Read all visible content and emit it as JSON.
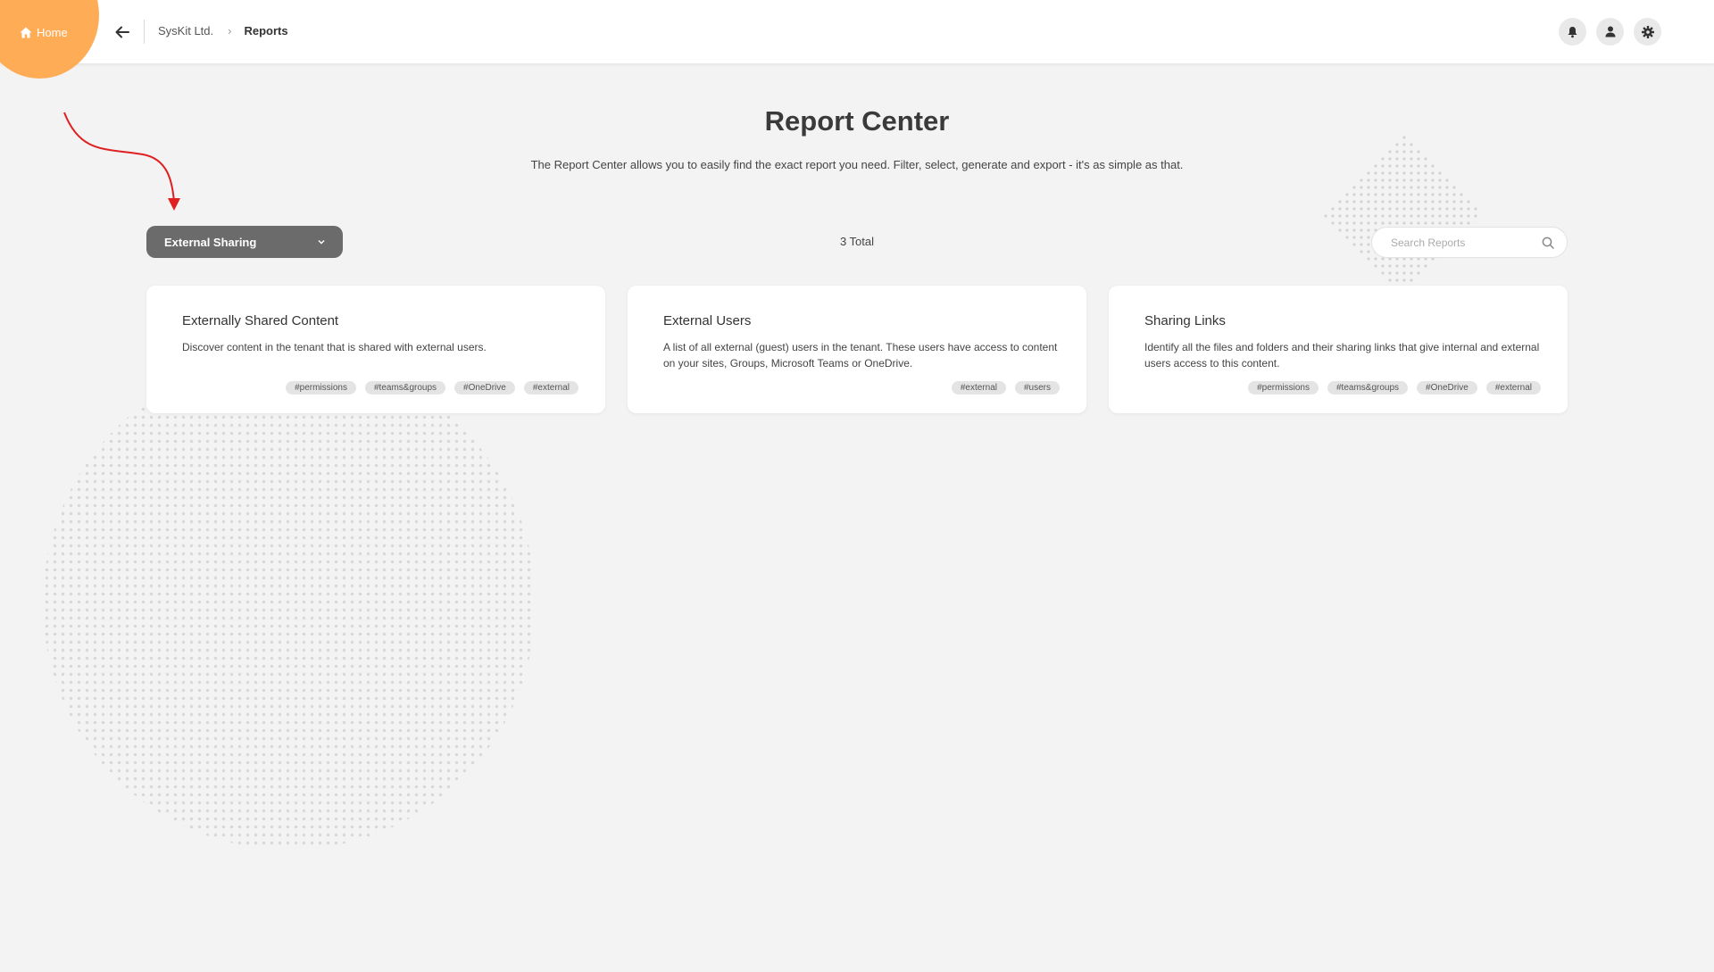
{
  "nav": {
    "home_label": "Home",
    "breadcrumb": {
      "root": "SysKit Ltd.",
      "current": "Reports"
    }
  },
  "header": {
    "title": "Report Center",
    "subtitle": "The Report Center allows you to easily find the exact report you need. Filter, select, generate and export - it's as simple as that."
  },
  "toolbar": {
    "filter_selected": "External Sharing",
    "total": "3 Total",
    "search_placeholder": "Search Reports"
  },
  "reports": [
    {
      "title": "Externally Shared Content",
      "description": "Discover content in the tenant that is shared with external users.",
      "tags": [
        "#permissions",
        "#teams&groups",
        "#OneDrive",
        "#external"
      ]
    },
    {
      "title": "External Users",
      "description": "A list of all external (guest) users in the tenant. These users have access to content on your sites, Groups, Microsoft Teams or OneDrive.",
      "tags": [
        "#external",
        "#users"
      ]
    },
    {
      "title": "Sharing Links",
      "description": "Identify all the files and folders and their sharing links that give internal and external users access to this content.",
      "tags": [
        "#permissions",
        "#teams&groups",
        "#OneDrive",
        "#external"
      ]
    }
  ],
  "colors": {
    "accent": "#ffac57",
    "background": "#f3f3f3",
    "dropdown": "#6b6b6b",
    "annotation_arrow": "#e02020"
  },
  "icons": {
    "home": "home-icon",
    "back": "arrow-left-icon",
    "notifications": "bell-icon",
    "profile": "user-icon",
    "settings": "gear-icon",
    "dropdown": "chevron-down-icon",
    "search": "search-icon"
  }
}
